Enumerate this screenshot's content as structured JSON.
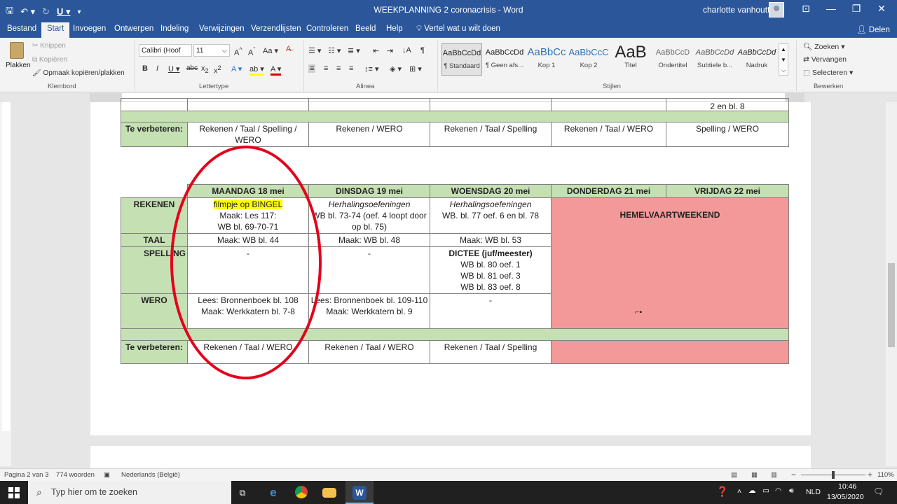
{
  "window": {
    "title": "WEEKPLANNING 2 coronacrisis  -  Word",
    "user": "charlotte vanhoutte"
  },
  "tabs": [
    "Bestand",
    "Start",
    "Invoegen",
    "Ontwerpen",
    "Indeling",
    "Verwijzingen",
    "Verzendlijsten",
    "Controleren",
    "Beeld",
    "Help"
  ],
  "tell_me": "Vertel wat u wilt doen",
  "share": "Delen",
  "ribbon": {
    "clipboard": {
      "paste": "Plakken",
      "cut": "Knippen",
      "copy": "Kopiëren",
      "format_painter": "Opmaak kopiëren/plakken",
      "label": "Klembord"
    },
    "font": {
      "name": "Calibri (Hoof",
      "size": "11",
      "label": "Lettertype"
    },
    "paragraph": {
      "label": "Alinea"
    },
    "styles": {
      "label": "Stijlen",
      "items": [
        {
          "preview": "AaBbCcDd",
          "name": "¶ Standaard"
        },
        {
          "preview": "AaBbCcDd",
          "name": "¶ Geen afs..."
        },
        {
          "preview": "AaBbCc",
          "name": "Kop 1"
        },
        {
          "preview": "AaBbCcC",
          "name": "Kop 2"
        },
        {
          "preview": "AaB",
          "name": "Titel"
        },
        {
          "preview": "AaBbCcD",
          "name": "Ondertitel"
        },
        {
          "preview": "AaBbCcDd",
          "name": "Subtiele b..."
        },
        {
          "preview": "AaBbCcDd",
          "name": "Nadruk"
        }
      ]
    },
    "editing": {
      "find": "Zoeken",
      "replace": "Vervangen",
      "select": "Selecteren",
      "label": "Bewerken"
    }
  },
  "document": {
    "table1": {
      "top_cells": [
        "",
        "",
        "",
        "",
        "",
        "2 en bl. 8"
      ],
      "row_label": "Te verbeteren:",
      "row": [
        "Rekenen / Taal / Spelling / WERO",
        "Rekenen / WERO",
        "Rekenen / Taal / Spelling",
        "Rekenen / Taal / WERO",
        "Spelling / WERO"
      ]
    },
    "table2": {
      "days": [
        "MAANDAG 18 mei",
        "DINSDAG 19 mei",
        "WOENSDAG 20 mei",
        "DONDERDAG 21 mei",
        "VRIJDAG 22 mei"
      ],
      "holiday": "HEMELVAARTWEEKEND",
      "rekenen": {
        "label": "REKENEN",
        "mon_highlight": "filmpje op BINGEL",
        "mon_l2": "Maak: Les 117:",
        "mon_l3": "WB bl. 69-70-71",
        "tue_l1": "Herhalingsoefeningen",
        "tue_l2": "WB bl. 73-74 (oef. 4 loopt door op bl. 75)",
        "wed_l1": "Herhalingsoefeningen",
        "wed_l2": "WB. bl. 77 oef. 6 en bl. 78"
      },
      "taal": {
        "label": "TAAL",
        "mon": "Maak: WB bl. 44",
        "tue": "Maak: WB bl. 48",
        "wed": "Maak: WB bl. 53"
      },
      "spelling": {
        "label": "SPELLING",
        "mon": "-",
        "tue": "-",
        "wed_title": "DICTEE (juf/meester)",
        "wed_l1": "WB bl. 80 oef. 1",
        "wed_l2": "WB bl. 81 oef. 3",
        "wed_l3": "WB bl. 83 oef. 8"
      },
      "wero": {
        "label": "WERO",
        "mon_l1": "Lees: Bronnenboek bl. 108",
        "mon_l2": "Maak: Werkkatern bl. 7-8",
        "tue_l1": "Lees: Bronnenboek bl. 109-110",
        "tue_l2": "Maak: Werkkatern bl. 9",
        "wed": "-"
      },
      "verbeteren": {
        "label": "Te verbeteren:",
        "mon": "Rekenen / Taal / WERO",
        "tue": "Rekenen / Taal / WERO",
        "wed": "Rekenen / Taal / Spelling"
      }
    }
  },
  "statusbar": {
    "page": "Pagina 2 van 3",
    "words": "774 woorden",
    "language": "Nederlands (België)",
    "zoom": "110%"
  },
  "taskbar": {
    "search_placeholder": "Typ hier om te zoeken",
    "language": "NLD",
    "time": "10:46",
    "date": "13/05/2020"
  },
  "colors": {
    "accent": "#2b579a",
    "table_green": "#c5e0b3",
    "table_red": "#f4999a",
    "highlight": "#ffff00",
    "circle": "#e4001b"
  }
}
